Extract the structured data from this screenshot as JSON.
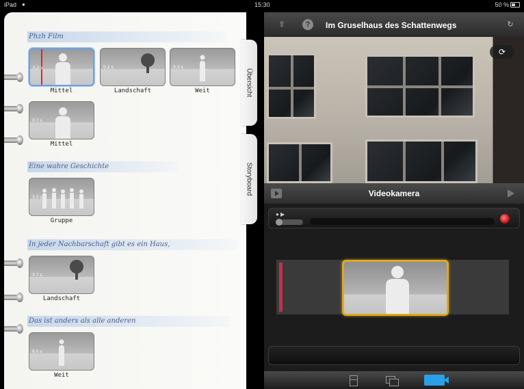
{
  "status_bar": {
    "device": "iPad",
    "time": "15:30",
    "battery": "50 %"
  },
  "storyboard": {
    "scenes": [
      {
        "title": "Phzh Film",
        "shots": [
          {
            "duration": "0.2 s",
            "label": "Mittel",
            "icon": "person-silhouette-icon",
            "selected": true
          },
          {
            "duration": "0.2 s",
            "label": "Landschaft",
            "icon": "tree-icon",
            "selected": false
          },
          {
            "duration": "0.3 s",
            "label": "Weit",
            "icon": "small-person-icon",
            "selected": false
          },
          {
            "duration": "0.7 s",
            "label": "Mittel",
            "icon": "person-silhouette-icon",
            "selected": false
          }
        ]
      },
      {
        "title": "Eine wahre Geschichte",
        "shots": [
          {
            "duration": "3.3 s",
            "label": "Gruppe",
            "icon": "group-icon",
            "selected": false
          }
        ]
      },
      {
        "title": "In jeder Nachbarschaft gibt es ein Haus,",
        "shots": [
          {
            "duration": "3.7 s",
            "label": "Landschaft",
            "icon": "tree-icon",
            "selected": false
          }
        ]
      },
      {
        "title": "Das ist anders als alle anderen",
        "shots": [
          {
            "duration": "6.0 s",
            "label": "Weit",
            "icon": "small-person-icon",
            "selected": false
          }
        ]
      }
    ],
    "tabs": {
      "overview": "Übersicht",
      "storyboard": "Storyboard"
    }
  },
  "right_panel": {
    "title": "Im Gruselhaus des Schattenwegs",
    "camera_header": "Videokamera",
    "accent_colors": {
      "record": "#c0181e",
      "timeline_selection": "#e0a81e",
      "active_tab": "#2aa0e6",
      "timeline_marker": "#c23050"
    }
  }
}
